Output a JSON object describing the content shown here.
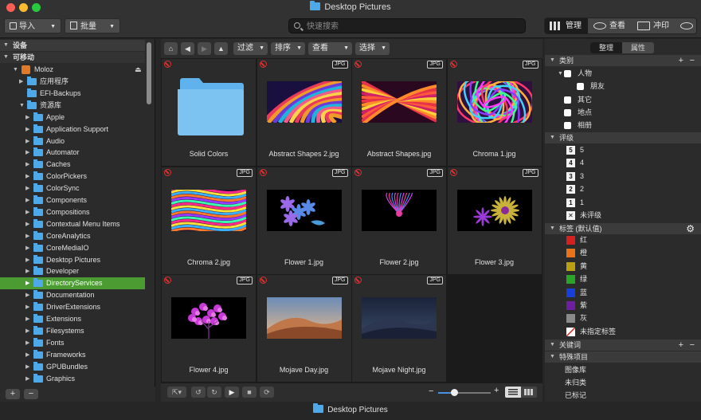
{
  "window": {
    "title": "Desktop Pictures"
  },
  "toolbar": {
    "import_label": "导入",
    "batch_label": "批量",
    "search_placeholder": "快速搜索",
    "manage_label": "管理",
    "view_label": "查看",
    "print_label": "冲印"
  },
  "sidebar": {
    "devices_label": "设备",
    "removable_label": "可移动",
    "drive_label": "Moloz",
    "items_top": [
      "应用程序",
      "EFI-Backups",
      "资源库"
    ],
    "library_items": [
      "Apple",
      "Application Support",
      "Audio",
      "Automator",
      "Caches",
      "ColorPickers",
      "ColorSync",
      "Components",
      "Compositions",
      "Contextual Menu Items",
      "CoreAnalytics",
      "CoreMediaIO",
      "Desktop Pictures",
      "Developer",
      "DirectoryServices",
      "Documentation",
      "DriverExtensions",
      "Extensions",
      "Filesystems",
      "Fonts",
      "Frameworks",
      "GPUBundles",
      "Graphics"
    ],
    "selected": "DirectoryServices",
    "add_label": "+",
    "remove_label": "−"
  },
  "browser_toolbar": {
    "filter_label": "过滤",
    "sort_label": "排序",
    "view_label": "查看",
    "select_label": "选择"
  },
  "files": [
    {
      "name": "Solid Colors",
      "badge": "",
      "kind": "folder"
    },
    {
      "name": "Abstract Shapes 2.jpg",
      "badge": "JPG",
      "kind": "abs2"
    },
    {
      "name": "Abstract Shapes.jpg",
      "badge": "JPG",
      "kind": "abs1"
    },
    {
      "name": "Chroma 1.jpg",
      "badge": "JPG",
      "kind": "chroma1"
    },
    {
      "name": "Chroma 2.jpg",
      "badge": "JPG",
      "kind": "chroma2"
    },
    {
      "name": "Flower 1.jpg",
      "badge": "JPG",
      "kind": "flower1"
    },
    {
      "name": "Flower 2.jpg",
      "badge": "JPG",
      "kind": "flower2"
    },
    {
      "name": "Flower 3.jpg",
      "badge": "JPG",
      "kind": "flower3"
    },
    {
      "name": "Flower 4.jpg",
      "badge": "JPG",
      "kind": "flower4"
    },
    {
      "name": "Mojave Day.jpg",
      "badge": "JPG",
      "kind": "mojaveday"
    },
    {
      "name": "Mojave Night.jpg",
      "badge": "JPG",
      "kind": "mojavenight"
    }
  ],
  "right_panel": {
    "tab_organize": "整理",
    "tab_properties": "属性",
    "category_header": "类别",
    "categories": [
      "人物",
      "朋友",
      "其它",
      "地点",
      "相册"
    ],
    "rating_header": "评级",
    "ratings": [
      {
        "num": "5",
        "label": "5"
      },
      {
        "num": "4",
        "label": "4"
      },
      {
        "num": "3",
        "label": "3"
      },
      {
        "num": "2",
        "label": "2"
      },
      {
        "num": "1",
        "label": "1"
      },
      {
        "num": "✕",
        "label": "未评级"
      }
    ],
    "tags_header": "标签 (默认值)",
    "tags": [
      {
        "label": "红",
        "color": "#d42020"
      },
      {
        "label": "橙",
        "color": "#e8731b"
      },
      {
        "label": "黄",
        "color": "#b8a012"
      },
      {
        "label": "绿",
        "color": "#2aa52a"
      },
      {
        "label": "蓝",
        "color": "#1a3fd6"
      },
      {
        "label": "紫",
        "color": "#6e1fa0"
      },
      {
        "label": "灰",
        "color": "#8a8a8a"
      },
      {
        "label": "未指定标签",
        "color": "none"
      }
    ],
    "keywords_header": "关键词",
    "special_header": "特殊项目",
    "special_items": [
      "图像库",
      "未归类",
      "已标记"
    ]
  },
  "statusbar": {
    "label": "Desktop Pictures"
  }
}
